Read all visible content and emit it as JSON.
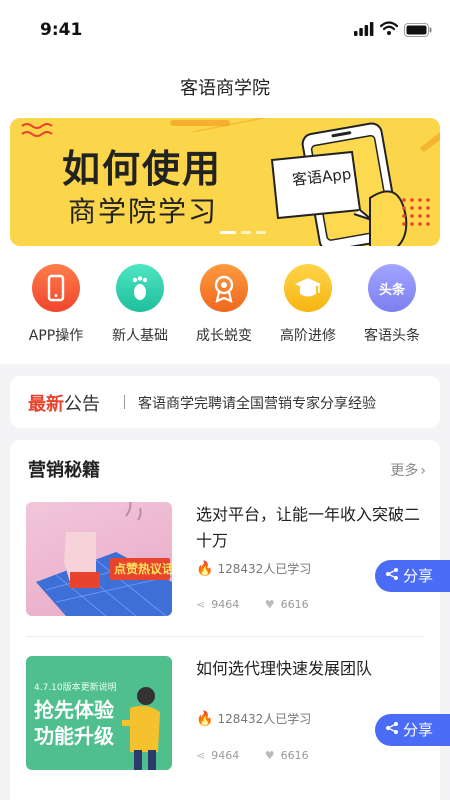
{
  "status_bar": {
    "time": "9:41"
  },
  "header": {
    "title": "客语商学院"
  },
  "banner": {
    "line1": "如何使用",
    "line2": "商学院学习",
    "app_label": "客语App",
    "dots": 3
  },
  "categories": [
    {
      "label": "APP操作",
      "icon": "phone-icon",
      "color": "#f45b3c"
    },
    {
      "label": "新人基础",
      "icon": "footprint-icon",
      "color": "#2fd2b0"
    },
    {
      "label": "成长蜕变",
      "icon": "medal-icon",
      "color": "#f77a2b"
    },
    {
      "label": "高阶进修",
      "icon": "graduation-cap-icon",
      "color": "#fcc51b"
    },
    {
      "label": "客语头条",
      "icon": "headline-icon",
      "color": "#8d8ff4",
      "icon_text": "头条"
    }
  ],
  "notice": {
    "badge_part1": "最新",
    "badge_part2": "公告",
    "text": "客语商学完聘请全国营销专家分享经验"
  },
  "section": {
    "title": "营销秘籍",
    "more": "更多",
    "articles": [
      {
        "title": "选对平台，让能一年收入突破二十万",
        "learners": "128432人已学习",
        "shares": "9464",
        "likes": "6616",
        "share_label": "分享",
        "thumb_text": "点赞热议话"
      },
      {
        "title": "如何选代理快速发展团队",
        "learners": "128432人已学习",
        "shares": "9464",
        "likes": "6616",
        "share_label": "分享",
        "thumb_text1": "4.7.10版本更新说明",
        "thumb_text2": "抢先体验",
        "thumb_text3": "功能升级"
      }
    ]
  },
  "colors": {
    "accent": "#4a6cf7",
    "banner": "#fbd54a",
    "notice_red": "#e8432d"
  }
}
